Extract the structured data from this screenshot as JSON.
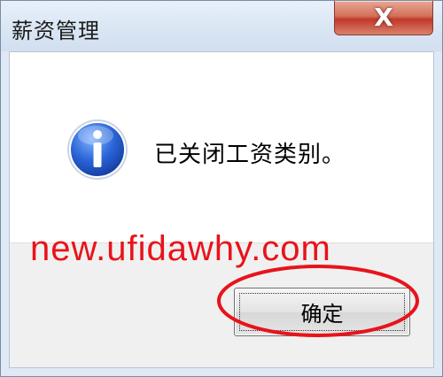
{
  "dialog": {
    "title": "薪资管理",
    "close_label": "X",
    "message": "已关闭工资类别。",
    "icon": "info-icon",
    "ok_label": "确定"
  },
  "watermark": {
    "text": "new.ufidawhy.com",
    "color": "#e8131b"
  },
  "annotation": {
    "color": "#e8131b",
    "target": "ok-button"
  }
}
